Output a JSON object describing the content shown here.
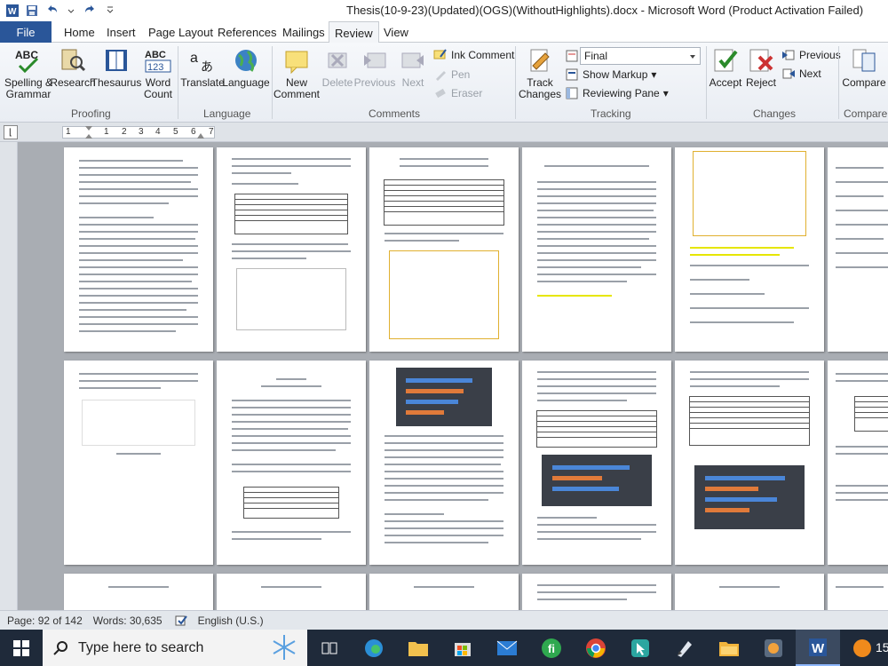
{
  "window": {
    "title": "Thesis(10-9-23)(Updated)(OGS)(WithoutHighlights).docx - Microsoft Word (Product Activation Failed)"
  },
  "tabs": [
    {
      "label": "File"
    },
    {
      "label": "Home"
    },
    {
      "label": "Insert"
    },
    {
      "label": "Page Layout"
    },
    {
      "label": "References"
    },
    {
      "label": "Mailings"
    },
    {
      "label": "Review"
    },
    {
      "label": "View"
    }
  ],
  "ribbon": {
    "proofing": {
      "label": "Proofing",
      "spelling": "Spelling &\nGrammar",
      "research": "Research",
      "thesaurus": "Thesaurus",
      "word_count": "Word\nCount"
    },
    "language": {
      "label": "Language",
      "translate": "Translate",
      "language": "Language"
    },
    "comments": {
      "label": "Comments",
      "new_comment": "New\nComment",
      "delete": "Delete",
      "previous": "Previous",
      "next": "Next",
      "ink_comment": "Ink Comment",
      "pen": "Pen",
      "eraser": "Eraser"
    },
    "tracking": {
      "label": "Tracking",
      "track_changes": "Track\nChanges",
      "display_mode": "Final",
      "show_markup": "Show Markup",
      "reviewing_pane": "Reviewing Pane"
    },
    "changes": {
      "label": "Changes",
      "accept": "Accept",
      "reject": "Reject",
      "previous": "Previous",
      "next": "Next"
    },
    "compare": {
      "label": "Compare",
      "compare": "Compare"
    }
  },
  "ruler": {
    "ticks": [
      "1",
      "1",
      "2",
      "3",
      "4",
      "5",
      "6",
      "7"
    ]
  },
  "status": {
    "page": "Page: 92 of 142",
    "words": "Words: 30,635",
    "language": "English (U.S.)"
  },
  "taskbar": {
    "search_placeholder": "Type here to search",
    "clock_fragment": "15"
  },
  "colors": {
    "file_tab": "#2a5699",
    "taskbar": "#1f2a3a",
    "canvas": "#a9adb3",
    "highlight": "#e6e600"
  }
}
